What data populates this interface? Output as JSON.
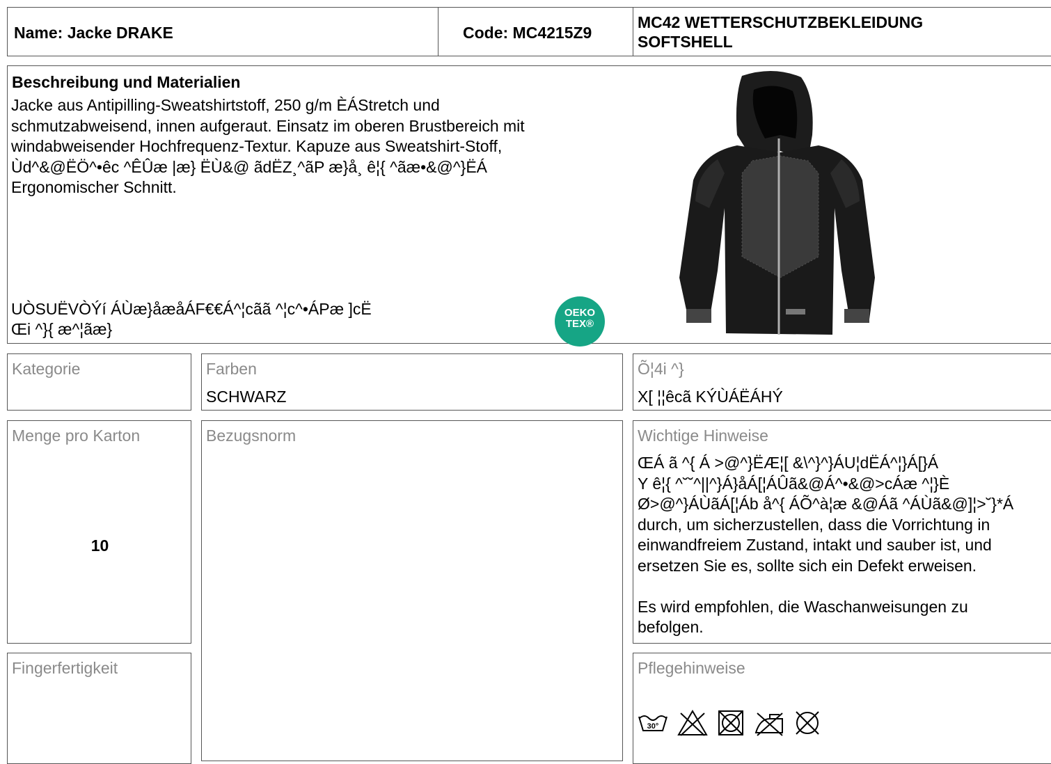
{
  "header": {
    "name": "Name: Jacke DRAKE",
    "code": "Code: MC4215Z9",
    "category_line1": "MC42 WETTERSCHUTZBEKLEIDUNG",
    "category_line2": "SOFTSHELL"
  },
  "description": {
    "title": "Beschreibung und Materialien",
    "lines": [
      "Jacke aus Antipilling-Sweatshirtstoff, 250 g/m ÈÁStretch und",
      "schmutzabweisend, innen aufgeraut. Einsatz im oberen Brustbereich mit",
      "windabweisender Hochfrequenz-Textur. Kapuze aus Sweatshirt-Stoff,",
      "Ùd^&@ËÖ^•êc ^ÊÛæ |æ} ËÙ&@ ãdËZ¸^ãP æ}å¸ ê¦{ ^ãæ•&@^}ËÁ",
      "Ergonomischer Schnitt."
    ],
    "garbled_lines": [
      "UÒSUËVÒÝí ÁÙæ}åæåÁF€€Á^¦cãã ^¦c^•ÁPæ ]cË",
      "Œi ^}{ æ^¦ãæ}"
    ],
    "badge_line1": "OEKO",
    "badge_line2": "TEX®"
  },
  "fields": {
    "kategorie": {
      "label": "Kategorie",
      "value": ""
    },
    "farben": {
      "label": "Farben",
      "value": "SCHWARZ"
    },
    "groessen": {
      "label": "Õ¦4i ^}",
      "value": "X[ ¦¦êcã KÝÙÁËÁHÝ"
    },
    "menge": {
      "label": "Menge pro Karton",
      "value": "10"
    },
    "bezugsnorm": {
      "label": "Bezugsnorm",
      "value": ""
    },
    "hinweise": {
      "label": "Wichtige Hinweise",
      "lines": [
        "ŒÁ ã ^{ Á >@^}ËÆ¦[ &\\^}^}ÁU¦dËÁ^¦}Á[}Á",
        "Y ê¦{ ^˘˘^||^}Á}åÁ[¦ÁÛã&@Á^•&@>cÁæ ^¦}È",
        "Ø>@^}ÁÙãÁ[¦Áb å^{ ÁÕ^à¦æ &@Áã ^ÁÙã&@]¦>˘}*Á",
        "durch, um sicherzustellen, dass die Vorrichtung in",
        "einwandfreiem Zustand, intakt und sauber ist, und",
        "ersetzen Sie es, sollte sich ein Defekt erweisen.",
        "",
        "Es wird empfohlen, die Waschanweisungen zu",
        "befolgen."
      ]
    },
    "finger": {
      "label": "Fingerfertigkeit",
      "value": ""
    },
    "pflege": {
      "label": "Pflegehinweise",
      "icons": [
        "wash-30-icon",
        "no-bleach-icon",
        "no-tumble-dry-icon",
        "no-iron-icon",
        "no-dry-clean-icon"
      ],
      "wash_temp": "30°"
    }
  }
}
